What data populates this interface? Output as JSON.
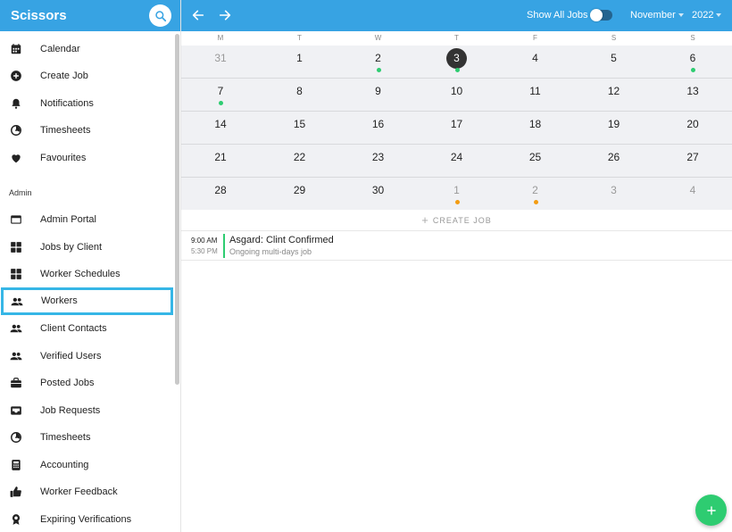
{
  "app": {
    "title": "Scissors"
  },
  "sidebar": {
    "items": [
      {
        "label": "Calendar",
        "icon": "calendar-icon"
      },
      {
        "label": "Create Job",
        "icon": "add-circle-icon"
      },
      {
        "label": "Notifications",
        "icon": "bell-icon"
      },
      {
        "label": "Timesheets",
        "icon": "timer-icon"
      },
      {
        "label": "Favourites",
        "icon": "heart-icon"
      }
    ],
    "section_label": "Admin",
    "admin_items": [
      {
        "label": "Admin Portal",
        "icon": "browser-window-icon"
      },
      {
        "label": "Jobs by Client",
        "icon": "grid-icon"
      },
      {
        "label": "Worker Schedules",
        "icon": "grid-icon"
      },
      {
        "label": "Workers",
        "icon": "people-icon",
        "selected": true
      },
      {
        "label": "Client Contacts",
        "icon": "people-icon"
      },
      {
        "label": "Verified Users",
        "icon": "people-icon"
      },
      {
        "label": "Posted Jobs",
        "icon": "briefcase-icon"
      },
      {
        "label": "Job Requests",
        "icon": "inbox-icon"
      },
      {
        "label": "Timesheets",
        "icon": "timer-icon"
      },
      {
        "label": "Accounting",
        "icon": "calculator-icon"
      },
      {
        "label": "Worker Feedback",
        "icon": "thumbs-up-icon"
      },
      {
        "label": "Expiring Verifications",
        "icon": "award-icon"
      }
    ]
  },
  "topbar": {
    "show_all_label": "Show All Jobs",
    "show_all_on": false,
    "month": "November",
    "year": "2022"
  },
  "calendar": {
    "weekdays": [
      "M",
      "T",
      "W",
      "T",
      "F",
      "S",
      "S"
    ],
    "weeks": [
      [
        {
          "d": "31",
          "other": true
        },
        {
          "d": "1"
        },
        {
          "d": "2",
          "dot": "green"
        },
        {
          "d": "3",
          "today": true,
          "dot": "green"
        },
        {
          "d": "4"
        },
        {
          "d": "5"
        },
        {
          "d": "6",
          "dot": "green"
        }
      ],
      [
        {
          "d": "7",
          "dot": "green"
        },
        {
          "d": "8"
        },
        {
          "d": "9"
        },
        {
          "d": "10"
        },
        {
          "d": "11"
        },
        {
          "d": "12"
        },
        {
          "d": "13"
        }
      ],
      [
        {
          "d": "14"
        },
        {
          "d": "15"
        },
        {
          "d": "16"
        },
        {
          "d": "17"
        },
        {
          "d": "18"
        },
        {
          "d": "19"
        },
        {
          "d": "20"
        }
      ],
      [
        {
          "d": "21"
        },
        {
          "d": "22"
        },
        {
          "d": "23"
        },
        {
          "d": "24"
        },
        {
          "d": "25"
        },
        {
          "d": "26"
        },
        {
          "d": "27"
        }
      ],
      [
        {
          "d": "28"
        },
        {
          "d": "29"
        },
        {
          "d": "30"
        },
        {
          "d": "1",
          "other": true,
          "dot": "orange"
        },
        {
          "d": "2",
          "other": true,
          "dot": "orange"
        },
        {
          "d": "3",
          "other": true
        },
        {
          "d": "4",
          "other": true
        }
      ]
    ],
    "dot_colors": {
      "green": "#2ecc71",
      "orange": "#f39c12"
    }
  },
  "create_job": {
    "label": "CREATE JOB"
  },
  "job": {
    "start": "9:00 AM",
    "end": "5:30 PM",
    "title": "Asgard: Clint Confirmed",
    "subtitle": "Ongoing multi-days job"
  },
  "fab": {
    "icon": "plus-icon"
  }
}
